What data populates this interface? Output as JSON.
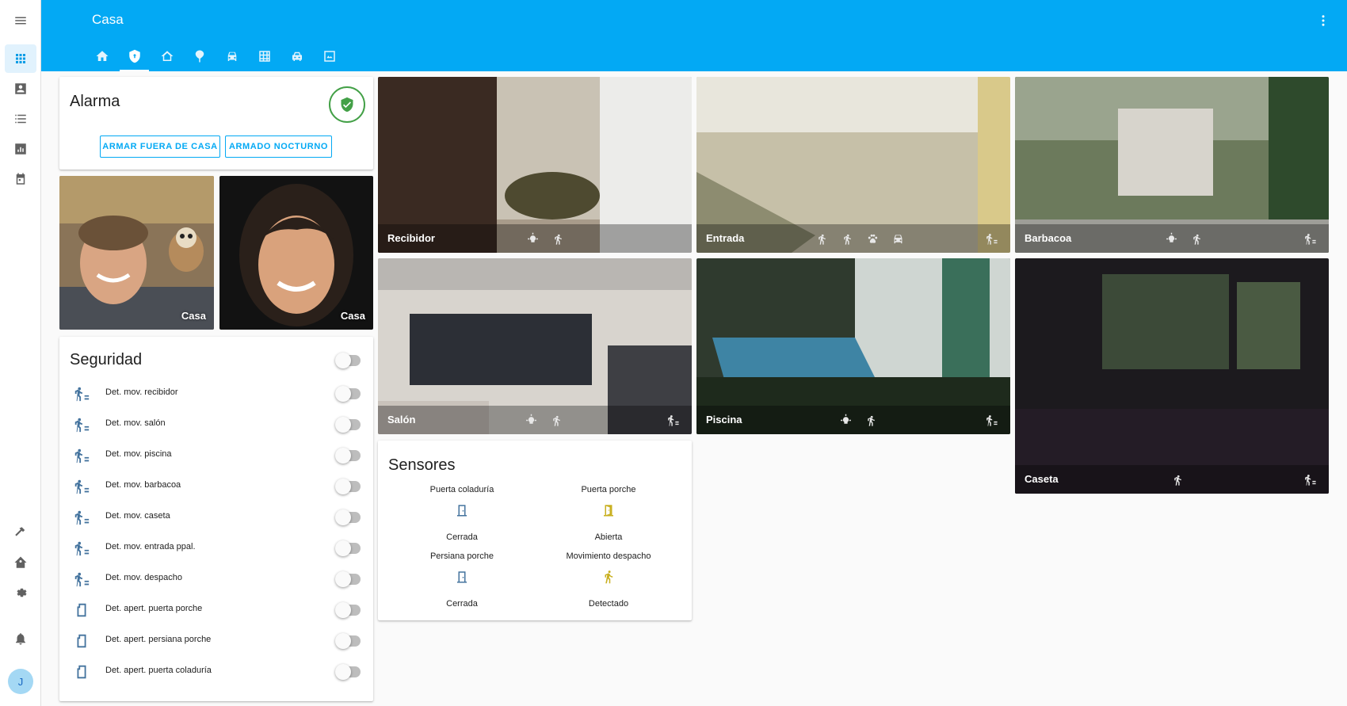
{
  "header": {
    "title": "Casa"
  },
  "sidebar": {
    "items": [
      {
        "icon": "apps-icon"
      },
      {
        "icon": "account-box-icon"
      },
      {
        "icon": "format-list-icon"
      },
      {
        "icon": "chart-box-icon"
      },
      {
        "icon": "calendar-icon"
      },
      {
        "icon": "hammer-icon"
      },
      {
        "icon": "home-assistant-icon"
      },
      {
        "icon": "settings-icon"
      },
      {
        "icon": "bell-icon"
      }
    ],
    "user_initial": "J"
  },
  "tabs": [
    {
      "icon": "home-icon"
    },
    {
      "icon": "shield-home-icon",
      "active": true
    },
    {
      "icon": "home-outline-icon"
    },
    {
      "icon": "flower-icon"
    },
    {
      "icon": "car-icon"
    },
    {
      "icon": "table-grid-icon"
    },
    {
      "icon": "car-side-icon"
    },
    {
      "icon": "image-panel-icon"
    }
  ],
  "alarm": {
    "title": "Alarma",
    "state_color": "#43a047",
    "buttons": {
      "arm_away": "ARMAR FUERA DE CASA",
      "arm_night": "ARMADO NOCTURNO"
    }
  },
  "persons": [
    {
      "state": "Casa"
    },
    {
      "state": "Casa"
    }
  ],
  "security": {
    "title": "Seguridad",
    "entities": [
      {
        "label": "Det. mov. recibidor",
        "icon": "motion-sensor-icon"
      },
      {
        "label": "Det. mov. salón",
        "icon": "motion-sensor-icon"
      },
      {
        "label": "Det. mov. piscina",
        "icon": "motion-sensor-icon"
      },
      {
        "label": "Det. mov. barbacoa",
        "icon": "motion-sensor-icon"
      },
      {
        "label": "Det. mov. caseta",
        "icon": "motion-sensor-icon"
      },
      {
        "label": "Det. mov. entrada ppal.",
        "icon": "motion-sensor-icon"
      },
      {
        "label": "Det. mov. despacho",
        "icon": "motion-sensor-icon"
      },
      {
        "label": "Det. apert. puerta porche",
        "icon": "door-sensor-icon"
      },
      {
        "label": "Det. apert. persiana porche",
        "icon": "door-sensor-icon"
      },
      {
        "label": "Det. apert. puerta coladuría",
        "icon": "door-sensor-icon"
      }
    ]
  },
  "cameras": [
    {
      "name": "Recibidor"
    },
    {
      "name": "Entrada"
    },
    {
      "name": "Barbacoa"
    },
    {
      "name": "Salón"
    },
    {
      "name": "Piscina"
    },
    {
      "name": "Caseta"
    }
  ],
  "sensors": {
    "title": "Sensores",
    "items": [
      {
        "name": "Puerta coladuría",
        "state": "Cerrada",
        "icon": "door-closed-icon",
        "color": "#44739e"
      },
      {
        "name": "Puerta porche",
        "state": "Abierta",
        "icon": "door-open-icon",
        "color": "#fdd835"
      },
      {
        "name": "Persiana porche",
        "state": "Cerrada",
        "icon": "door-closed-icon",
        "color": "#44739e"
      },
      {
        "name": "Movimiento despacho",
        "state": "Detectado",
        "icon": "run-icon",
        "color": "#fdd835"
      }
    ]
  }
}
